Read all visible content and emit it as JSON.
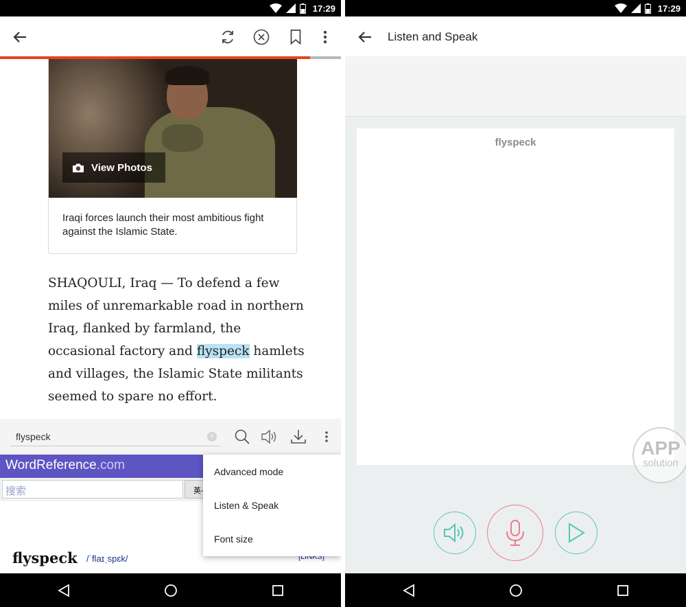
{
  "status": {
    "time": "17:29"
  },
  "left": {
    "progress": 0.91,
    "photo": {
      "view_label": "View Photos"
    },
    "caption": "Iraqi forces launch their most ambitious fight against the Islamic State.",
    "article": {
      "before": "SHAQOULI, Iraq — To defend a few miles of unremarkable road in northern Iraq, flanked by farmland, the occasional factory and ",
      "highlight": "flyspeck",
      "after": " hamlets and villages, the Islamic State militants seemed to spare no effort."
    },
    "dict": {
      "query": "flyspeck",
      "brand": "WordReference",
      "brand_domain": ".com",
      "search_placeholder": "搜索",
      "lang_select": "英-",
      "headword": "flyspeck",
      "ipa": "/ˈflaɪˌspɛk/",
      "links": "[LINKS]"
    },
    "menu": [
      "Advanced mode",
      "Listen & Speak",
      "Font size"
    ]
  },
  "right": {
    "title": "Listen and Speak",
    "word": "flyspeck",
    "watermark": {
      "top": "APP",
      "bottom": "solution"
    }
  }
}
